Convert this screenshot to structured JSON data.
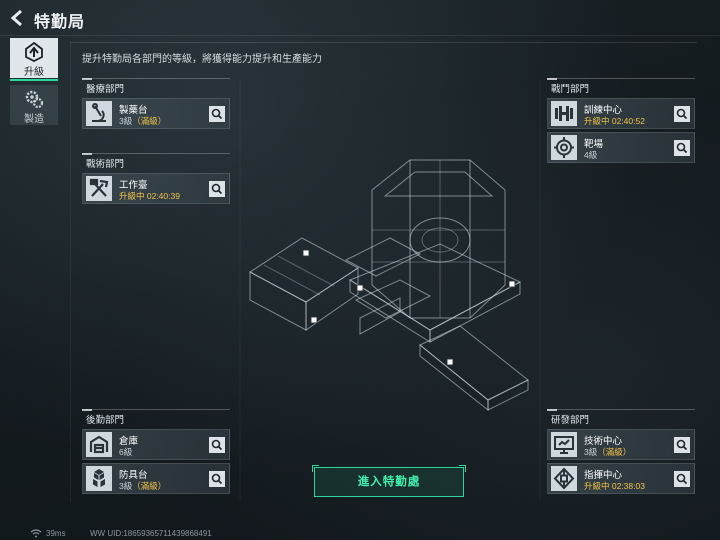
{
  "header": {
    "title": "特勤局"
  },
  "tabs": [
    {
      "label": "升級",
      "icon": "upgrade-icon",
      "active": true
    },
    {
      "label": "製造",
      "icon": "gears-icon",
      "active": false
    }
  ],
  "subtitle": "提升特勤局各部門的等級，將獲得能力提升和生產能力",
  "sections": {
    "medical": {
      "title": "醫療部門",
      "items": [
        {
          "name": "製藥台",
          "level": "3級",
          "maxed": "（滿級）",
          "icon": "microscope-icon"
        }
      ]
    },
    "tactical": {
      "title": "戰術部門",
      "items": [
        {
          "name": "工作臺",
          "status": "升級中 02:40:39",
          "icon": "tools-icon"
        }
      ]
    },
    "logistics": {
      "title": "後勤部門",
      "items": [
        {
          "name": "倉庫",
          "level": "6級",
          "icon": "warehouse-icon"
        },
        {
          "name": "防具台",
          "level": "3級",
          "maxed": "（滿級）",
          "icon": "boxes-icon"
        }
      ]
    },
    "combat": {
      "title": "戰鬥部門",
      "items": [
        {
          "name": "訓練中心",
          "status": "升級中 02:40:52",
          "icon": "dumbbell-icon"
        },
        {
          "name": "靶場",
          "level": "4級",
          "icon": "target-icon"
        }
      ]
    },
    "research": {
      "title": "研發部門",
      "items": [
        {
          "name": "技術中心",
          "level": "3級",
          "maxed": "（滿級）",
          "icon": "monitor-icon"
        },
        {
          "name": "指揮中心",
          "status": "升級中 02:38:03",
          "icon": "chip-icon"
        }
      ]
    }
  },
  "enter_button": "進入特勤處",
  "footer": {
    "ping": "39ms",
    "uid": "WW UID:18659365711439868491"
  },
  "colors": {
    "accent": "#2ed79a",
    "upgrading": "#f1c24a",
    "panel": "#46545c"
  }
}
